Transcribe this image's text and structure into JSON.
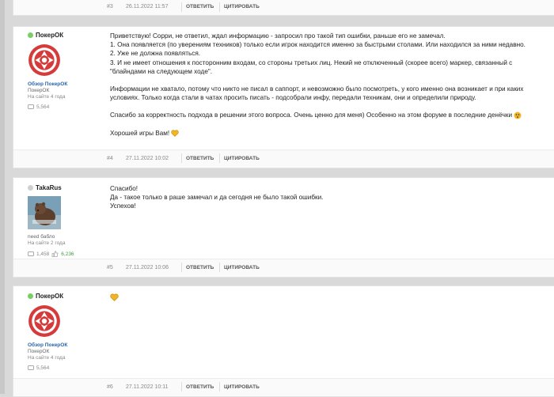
{
  "posts": [
    {
      "num": "#3",
      "date": "26.11.2022 11:57",
      "reply": "ОТВЕТИТЬ",
      "quote": "ЦИТИРОВАТЬ"
    },
    {
      "user": "ПокерОК",
      "online": true,
      "title": "Обзор ПокерОК",
      "rank": "ПокерОК",
      "since": "На сайте 4 года",
      "posts_count": "5,564",
      "lines": [
        "Приветствую! Сорри, не ответил, ждал информацию - запросил про такой тип ошибки, раньше его не замечал.",
        "1. Она появляется (по уверениям техников) только если игрок находится именно за быстрыми столами. Или находился за ними недавно.",
        "2. Уже не должна появляться.",
        "3. И не имеет отношения к посторонним входам, со стороны третьих лиц. Некий не отключенный (скорее всего) маркер, связанный с",
        "\"блайндами на следующем ходе\".",
        "",
        "Информации не хватало, потому что никто не писал в саппорт, и невозможно было посмотреть, у кого именно она возникает и при каких",
        "условиях. Только когда стали в чатах просить писать - подсобрали инфу, передали техникам, они и определили природу.",
        "",
        "Спасибо за корректность подхода в решении этого вопроса. Очень ценно для меня) Особенно на этом форуме в последние денёчки",
        "",
        "Хорошей игры Вам!"
      ],
      "num": "#4",
      "date": "27.11.2022 10:02",
      "reply": "ОТВЕТИТЬ",
      "quote": "ЦИТИРОВАТЬ"
    },
    {
      "user": "TakaRus",
      "online": false,
      "rank": "need бабло",
      "since": "На сайте 2 года",
      "posts_count": "1,458",
      "likes": "6,236",
      "lines": [
        "Спасибо!",
        "Да - такое только в раше замечал и да сегодня не было такой ошибки.",
        "Успехов!"
      ],
      "num": "#5",
      "date": "27.11.2022 10:06",
      "reply": "ОТВЕТИТЬ",
      "quote": "ЦИТИРОВАТЬ"
    },
    {
      "user": "ПокерОК",
      "online": true,
      "title": "Обзор ПокерОК",
      "rank": "ПокерОК",
      "since": "На сайте 4 года",
      "posts_count": "5,564",
      "num": "#6",
      "date": "27.11.2022 10:11",
      "reply": "ОТВЕТИТЬ",
      "quote": "ЦИТИРОВАТЬ"
    }
  ],
  "colors": {
    "online": "#7ccd63",
    "offline": "#cfcfcf",
    "link": "#2a66a8",
    "heart": "#f2b524"
  }
}
